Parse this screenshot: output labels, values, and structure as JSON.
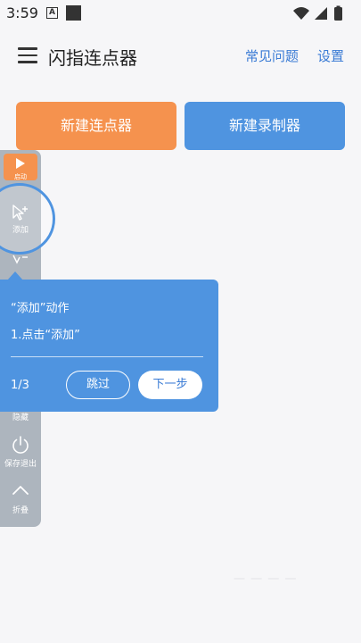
{
  "status_bar": {
    "time": "3:59",
    "notif_letter": "A"
  },
  "app_bar": {
    "title": "闪指连点器",
    "faq_label": "常见问题",
    "settings_label": "设置"
  },
  "main": {
    "new_clicker_label": "新建连点器",
    "new_recorder_label": "新建录制器"
  },
  "floating_panel": {
    "play_label": "启动",
    "add_label": "添加",
    "hide_label": "隐藏",
    "save_exit_label": "保存退出",
    "fold_label": "折叠"
  },
  "tooltip": {
    "title": "“添加”动作",
    "step_text": "1.点击“添加”",
    "progress": "1/3",
    "skip_label": "跳过",
    "next_label": "下一步"
  },
  "faded_overlay_text": "一 一 一 一",
  "colors": {
    "accent_orange": "#f5924e",
    "accent_blue": "#4f94e0",
    "panel_gray": "#a9b1ba",
    "link_blue": "#3a7bd5"
  }
}
